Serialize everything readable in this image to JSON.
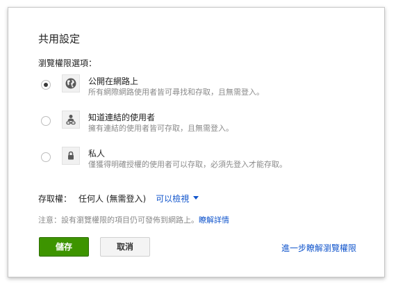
{
  "dialog": {
    "title": "共用設定",
    "section_label": "瀏覽權限選項："
  },
  "options": [
    {
      "icon": "globe-icon",
      "title": "公開在網路上",
      "description": "所有網際網路使用者皆可尋找和存取，且無需登入。",
      "selected": true
    },
    {
      "icon": "link-people-icon",
      "title": "知道連結的使用者",
      "description": "擁有連結的使用者皆可存取，且無需登入。",
      "selected": false
    },
    {
      "icon": "lock-icon",
      "title": "私人",
      "description": "僅獲得明確授權的使用者可以存取，必須先登入才能存取。",
      "selected": false
    }
  ],
  "access": {
    "label": "存取權：",
    "who": "任何人 (無需登入)",
    "permission": "可以檢視"
  },
  "note": {
    "text": "注意：設有瀏覽權限的項目仍可發佈到網路上。",
    "link": "瞭解詳情"
  },
  "buttons": {
    "save": "儲存",
    "cancel": "取消"
  },
  "learn_more": "進一步瞭解瀏覽權限",
  "colors": {
    "save_green": "#3d9400",
    "link_blue": "#1155cc"
  }
}
